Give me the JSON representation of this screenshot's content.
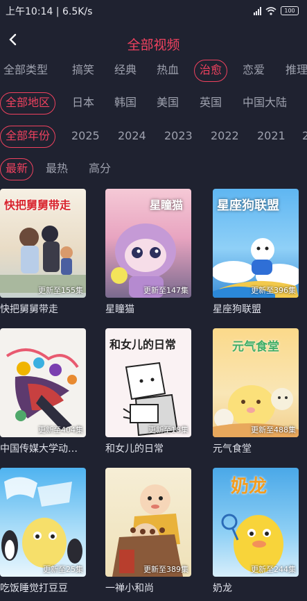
{
  "status_bar": {
    "text": "上午10:14 | 6.5K/s",
    "battery": "100"
  },
  "header": {
    "title": "全部视频"
  },
  "filters": {
    "types": [
      "全部类型",
      "搞笑",
      "经典",
      "热血",
      "治愈",
      "恋爱",
      "推理"
    ],
    "regions": [
      "全部地区",
      "日本",
      "韩国",
      "美国",
      "英国",
      "中国大陆"
    ],
    "years": [
      "全部年份",
      "2025",
      "2024",
      "2023",
      "2022",
      "2021",
      "2"
    ],
    "sorts": [
      "最新",
      "最热",
      "高分"
    ]
  },
  "videos": [
    {
      "title": "快把舅舅带走",
      "update": "更新至155集",
      "poster_text": "快把舅舅带走"
    },
    {
      "title": "星瞳猫",
      "update": "更新至147集",
      "poster_text": "星瞳猫"
    },
    {
      "title": "星座狗联盟",
      "update": "更新至396集",
      "poster_text": "星座狗联盟"
    },
    {
      "title": "中国传媒大学动…",
      "update": "更新至404集",
      "poster_text": ""
    },
    {
      "title": "和女儿的日常",
      "update": "更新至18集",
      "poster_text": "和女儿的日常"
    },
    {
      "title": "元气食堂",
      "update": "更新至488集",
      "poster_text": "元气食堂"
    },
    {
      "title": "吃饭睡觉打豆豆",
      "update": "更新至25集",
      "poster_text": ""
    },
    {
      "title": "一禅小和尚",
      "update": "更新至389集",
      "poster_text": ""
    },
    {
      "title": "奶龙",
      "update": "更新至244集",
      "poster_text": "奶龙"
    }
  ],
  "colors": {
    "accent": "#f0425f",
    "background": "#1f2230"
  }
}
